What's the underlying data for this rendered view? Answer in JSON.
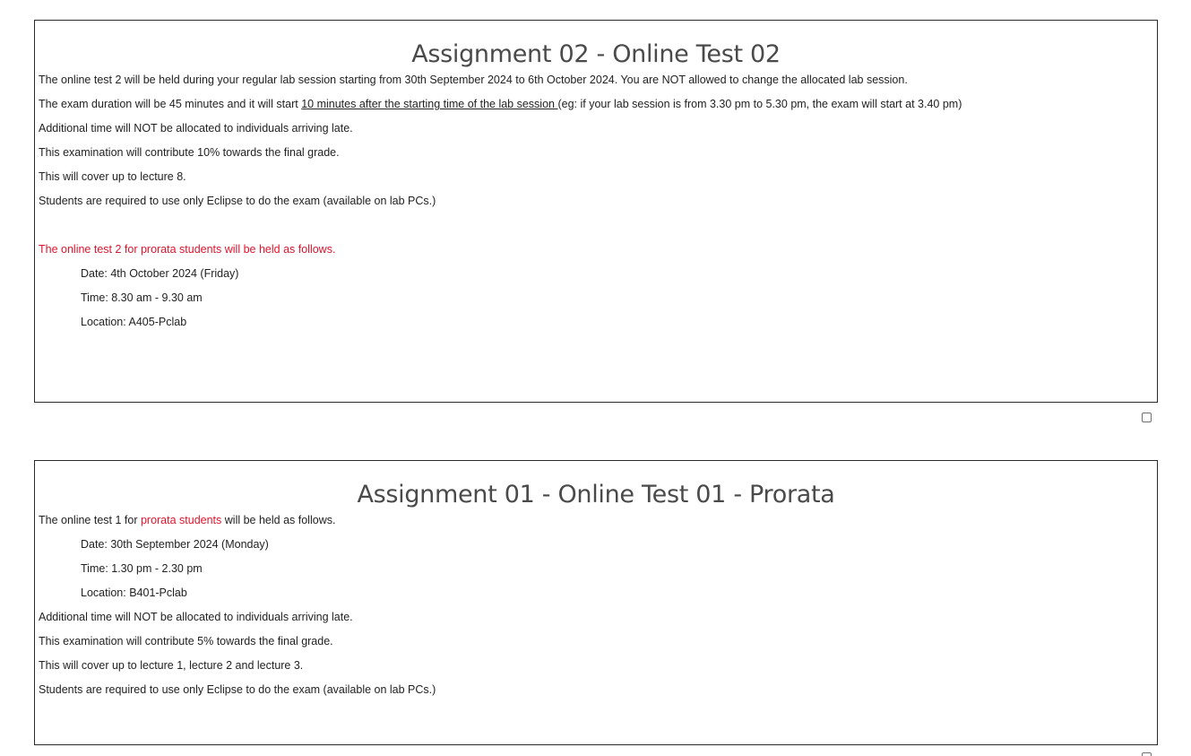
{
  "assignment2": {
    "title": "Assignment 02 - Online Test 02",
    "line1": "The online test 2 will be held during your regular lab session starting from 30th September 2024 to 6th October 2024. You are NOT allowed to change the allocated lab session.",
    "line2_pre": "The exam duration will be 45 minutes and it will start ",
    "line2_underlined": "10 minutes after the starting time of the lab session ",
    "line2_post": "(eg: if your lab session is from 3.30 pm to 5.30 pm, the exam will start at 3.40 pm)",
    "line3": "Additional time will NOT be allocated to individuals arriving late.",
    "line4": "This examination will contribute 10% towards the final grade.",
    "line5": "This will cover up to lecture 8.",
    "line6": "Students are required to use only Eclipse to do the exam (available on lab PCs.)",
    "prorata_notice": "The online test 2 for prorata students will be held as follows.",
    "date": "Date: 4th October 2024 (Friday)",
    "time": "Time: 8.30 am - 9.30 am",
    "location": "Location: A405-Pclab"
  },
  "assignment1": {
    "title": "Assignment 01 - Online Test 01 - Prorata",
    "intro_pre": "The online test 1 for ",
    "intro_red": "prorata students",
    "intro_post": " will be held as follows.",
    "date": "Date: 30th September 2024 (Monday)",
    "time": "Time: 1.30 pm - 2.30 pm",
    "location": "Location: B401-Pclab",
    "line1": "Additional time will NOT be allocated to individuals arriving late.",
    "line2": "This examination will contribute 5% towards the final grade.",
    "line3": "This will cover up to lecture 1, lecture 2 and lecture 3.",
    "line4": "Students are required to use only Eclipse to do the exam (available on lab PCs.)"
  },
  "colors": {
    "highlight_red": "#e0142c",
    "title_gray": "#4a4a4a",
    "border": "#2a2a2a"
  }
}
